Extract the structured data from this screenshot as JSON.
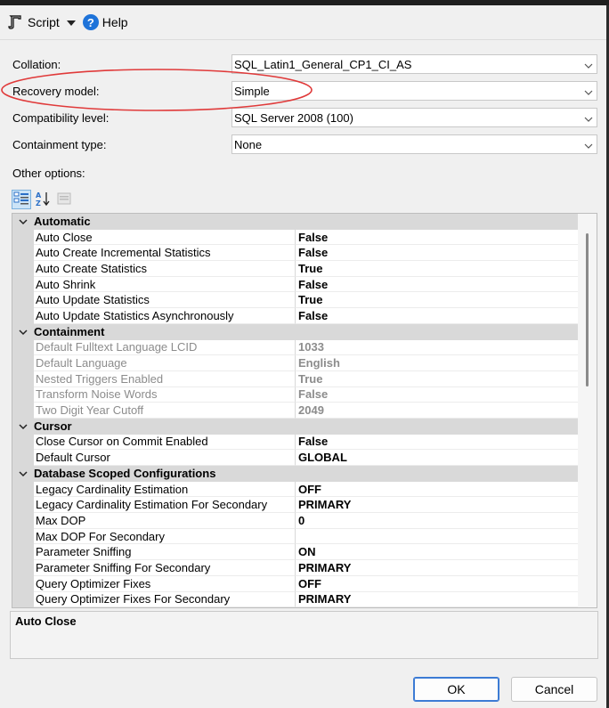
{
  "toolbar": {
    "script_label": "Script",
    "help_label": "Help",
    "script_icon": "script-icon",
    "help_icon": "help-icon",
    "help_glyph": "?"
  },
  "fields": {
    "collation": {
      "label": "Collation:",
      "value": "SQL_Latin1_General_CP1_CI_AS"
    },
    "recovery_model": {
      "label": "Recovery model:",
      "value": "Simple"
    },
    "compatibility_level": {
      "label": "Compatibility level:",
      "value": "SQL Server 2008 (100)"
    },
    "containment_type": {
      "label": "Containment type:",
      "value": "None"
    }
  },
  "highlight_color": "#e03a3a",
  "other_options_label": "Other options:",
  "property_grid": {
    "categories": [
      {
        "name": "Automatic",
        "rows": [
          {
            "name": "Auto Close",
            "value": "False"
          },
          {
            "name": "Auto Create Incremental Statistics",
            "value": "False"
          },
          {
            "name": "Auto Create Statistics",
            "value": "True"
          },
          {
            "name": "Auto Shrink",
            "value": "False"
          },
          {
            "name": "Auto Update Statistics",
            "value": "True"
          },
          {
            "name": "Auto Update Statistics Asynchronously",
            "value": "False"
          }
        ]
      },
      {
        "name": "Containment",
        "rows": [
          {
            "name": "Default Fulltext Language LCID",
            "value": "1033",
            "readonly": true
          },
          {
            "name": "Default Language",
            "value": "English",
            "readonly": true
          },
          {
            "name": "Nested Triggers Enabled",
            "value": "True",
            "readonly": true
          },
          {
            "name": "Transform Noise Words",
            "value": "False",
            "readonly": true
          },
          {
            "name": "Two Digit Year Cutoff",
            "value": "2049",
            "readonly": true
          }
        ]
      },
      {
        "name": "Cursor",
        "rows": [
          {
            "name": "Close Cursor on Commit Enabled",
            "value": "False"
          },
          {
            "name": "Default Cursor",
            "value": "GLOBAL"
          }
        ]
      },
      {
        "name": "Database Scoped Configurations",
        "rows": [
          {
            "name": "Legacy Cardinality Estimation",
            "value": "OFF"
          },
          {
            "name": "Legacy Cardinality Estimation For Secondary",
            "value": "PRIMARY"
          },
          {
            "name": "Max DOP",
            "value": "0"
          },
          {
            "name": "Max DOP For Secondary",
            "value": ""
          },
          {
            "name": "Parameter Sniffing",
            "value": "ON"
          },
          {
            "name": "Parameter Sniffing For Secondary",
            "value": "PRIMARY"
          },
          {
            "name": "Query Optimizer Fixes",
            "value": "OFF"
          },
          {
            "name": "Query Optimizer Fixes For Secondary",
            "value": "PRIMARY"
          }
        ]
      }
    ]
  },
  "description": {
    "title": "Auto Close"
  },
  "buttons": {
    "ok": "OK",
    "cancel": "Cancel"
  }
}
